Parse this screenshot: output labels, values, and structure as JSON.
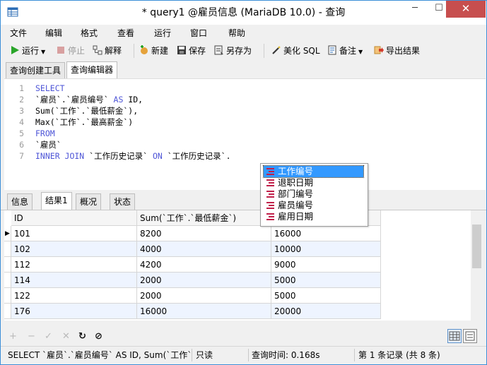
{
  "window": {
    "title": "* query1 @雇员信息 (MariaDB 10.0) - 查询",
    "minimize": "─",
    "maximize": "☐",
    "close": "✕"
  },
  "menubar": {
    "items": [
      "文件",
      "编辑",
      "格式",
      "查看",
      "运行",
      "窗口",
      "帮助"
    ]
  },
  "toolbar": {
    "run": "运行",
    "stop": "停止",
    "explain": "解释",
    "new": "新建",
    "save": "保存",
    "save_as": "另存为",
    "beautify": "美化 SQL",
    "comment": "备注",
    "export": "导出结果"
  },
  "top_tabs": [
    "查询创建工具",
    "查询编辑器"
  ],
  "editor": {
    "line_numbers": [
      "1",
      "2",
      "3",
      "4",
      "5",
      "6",
      "7"
    ],
    "lines": [
      [
        {
          "t": "SELECT",
          "kw": true
        }
      ],
      [
        {
          "t": "`雇员`.`雇员编号` ",
          "kw": false
        },
        {
          "t": "AS",
          "kw": true
        },
        {
          "t": " ID,",
          "kw": false
        }
      ],
      [
        {
          "t": "Sum(`工作`.`最低薪金`),",
          "kw": false
        }
      ],
      [
        {
          "t": "Max(`工作`.`最高薪金`)",
          "kw": false
        }
      ],
      [
        {
          "t": "FROM",
          "kw": true
        }
      ],
      [
        {
          "t": "`雇员`",
          "kw": false
        }
      ],
      [
        {
          "t": "INNER JOIN",
          "kw": true
        },
        {
          "t": " `工作历史记录` ",
          "kw": false
        },
        {
          "t": "ON",
          "kw": true
        },
        {
          "t": " `工作历史记录`.",
          "kw": false
        }
      ]
    ]
  },
  "autocomplete": {
    "items": [
      "工作编号",
      "退职日期",
      "部门编号",
      "雇员编号",
      "雇用日期"
    ],
    "selected_index": 0
  },
  "result_tabs": [
    "信息",
    "结果1",
    "概况",
    "状态"
  ],
  "grid": {
    "columns": [
      "ID",
      "Sum(`工作`.`最低薪金`)",
      ""
    ],
    "rows": [
      [
        "101",
        "8200",
        "16000"
      ],
      [
        "102",
        "4000",
        "10000"
      ],
      [
        "112",
        "4200",
        "9000"
      ],
      [
        "114",
        "2000",
        "5000"
      ],
      [
        "122",
        "2000",
        "5000"
      ],
      [
        "176",
        "16000",
        "20000"
      ]
    ],
    "current_row_marker": "▶"
  },
  "bottombar": {
    "add": "+",
    "remove": "−",
    "confirm": "✓",
    "cancel": "✕",
    "refresh": "↻",
    "stop": "⊘"
  },
  "status": {
    "query": "SELECT `雇员`.`雇员编号` AS ID, Sum(`工作`.`最",
    "mode": "只读",
    "time": "查询时间: 0.168s",
    "records": "第 1 条记录 (共 8 条)"
  },
  "colors": {
    "keyword": "#4e55d7",
    "selection": "#3399ff",
    "close_button": "#c74e4e",
    "field_icon": "#c0204a"
  }
}
